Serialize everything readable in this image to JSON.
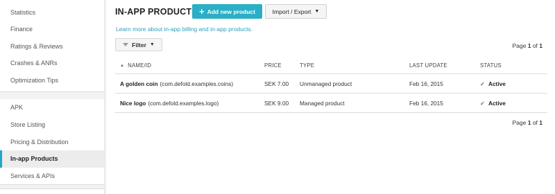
{
  "sidebar": {
    "group1": [
      {
        "label": "Statistics"
      },
      {
        "label": "Finance"
      },
      {
        "label": "Ratings & Reviews"
      },
      {
        "label": "Crashes & ANRs"
      },
      {
        "label": "Optimization Tips"
      }
    ],
    "group2": [
      {
        "label": "APK"
      },
      {
        "label": "Store Listing"
      },
      {
        "label": "Pricing & Distribution"
      },
      {
        "label": "In-app Products",
        "active": true
      },
      {
        "label": "Services & APIs"
      }
    ]
  },
  "header": {
    "title": "IN-APP PRODUCTS",
    "add_button": "Add new product",
    "import_button": "Import / Export"
  },
  "learn_more": "Learn more about in-app billing and in-app products.",
  "filter_label": "Filter",
  "pager": {
    "prefix": "Page ",
    "current": "1",
    "middle": " of ",
    "total": "1"
  },
  "table": {
    "columns": {
      "name": "NAME/ID",
      "price": "PRICE",
      "type": "TYPE",
      "last_update": "LAST UPDATE",
      "status": "STATUS"
    },
    "rows": [
      {
        "name": "A golden coin",
        "id": "(com.defold.examples.coins)",
        "price": "SEK 7.00",
        "type": "Unmanaged product",
        "last_update": "Feb 16, 2015",
        "status": "Active"
      },
      {
        "name": "Nice logo",
        "id": "(com.defold.examples.logo)",
        "price": "SEK 9.00",
        "type": "Managed product",
        "last_update": "Feb 16, 2015",
        "status": "Active"
      }
    ]
  },
  "colors": {
    "accent": "#2aafc6",
    "link": "#2aa0c0",
    "active_bar": "#1ea8c8"
  },
  "icons": {
    "add": "plus-icon",
    "dropdown": "caret-down-icon",
    "filter": "funnel-icon",
    "sort": "sort-ascending-icon",
    "status": "checkmark-icon"
  }
}
